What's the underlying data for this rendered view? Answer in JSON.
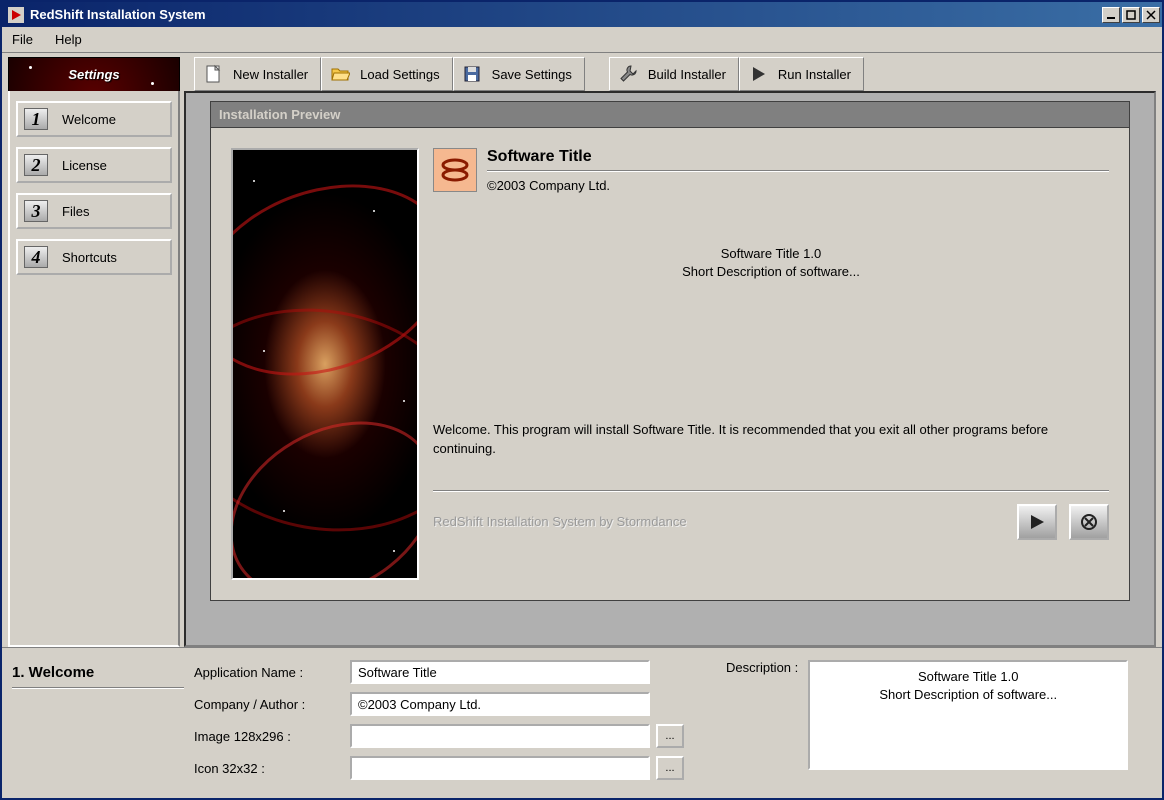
{
  "window": {
    "title": "RedShift Installation System"
  },
  "menu": {
    "file": "File",
    "help": "Help"
  },
  "tabs": {
    "settings": "Settings"
  },
  "toolbar": {
    "new": "New Installer",
    "load": "Load Settings",
    "save": "Save Settings",
    "build": "Build Installer",
    "run": "Run Installer"
  },
  "sidebar": {
    "items": [
      {
        "num": "1",
        "label": "Welcome"
      },
      {
        "num": "2",
        "label": "License"
      },
      {
        "num": "3",
        "label": "Files"
      },
      {
        "num": "4",
        "label": "Shortcuts"
      }
    ]
  },
  "preview": {
    "panel_title": "Installation Preview",
    "app_title": "Software Title",
    "copyright": "©2003 Company Ltd.",
    "version_line": "Software Title 1.0",
    "short_desc": "Short Description of software...",
    "welcome_msg": "Welcome.  This program will install Software Title.  It is recommended that you exit all other programs before continuing.",
    "credits": "RedShift Installation System by Stormdance"
  },
  "form": {
    "section": "1. Welcome",
    "app_name_label": "Application Name :",
    "app_name_value": "Software Title",
    "company_label": "Company / Author :",
    "company_value": "©2003 Company Ltd.",
    "image_label": "Image 128x296 :",
    "image_value": "",
    "icon_label": "Icon 32x32 :",
    "icon_value": "",
    "browse": "...",
    "desc_label": "Description :",
    "desc_line1": "Software Title 1.0",
    "desc_line2": "Short Description of software..."
  }
}
